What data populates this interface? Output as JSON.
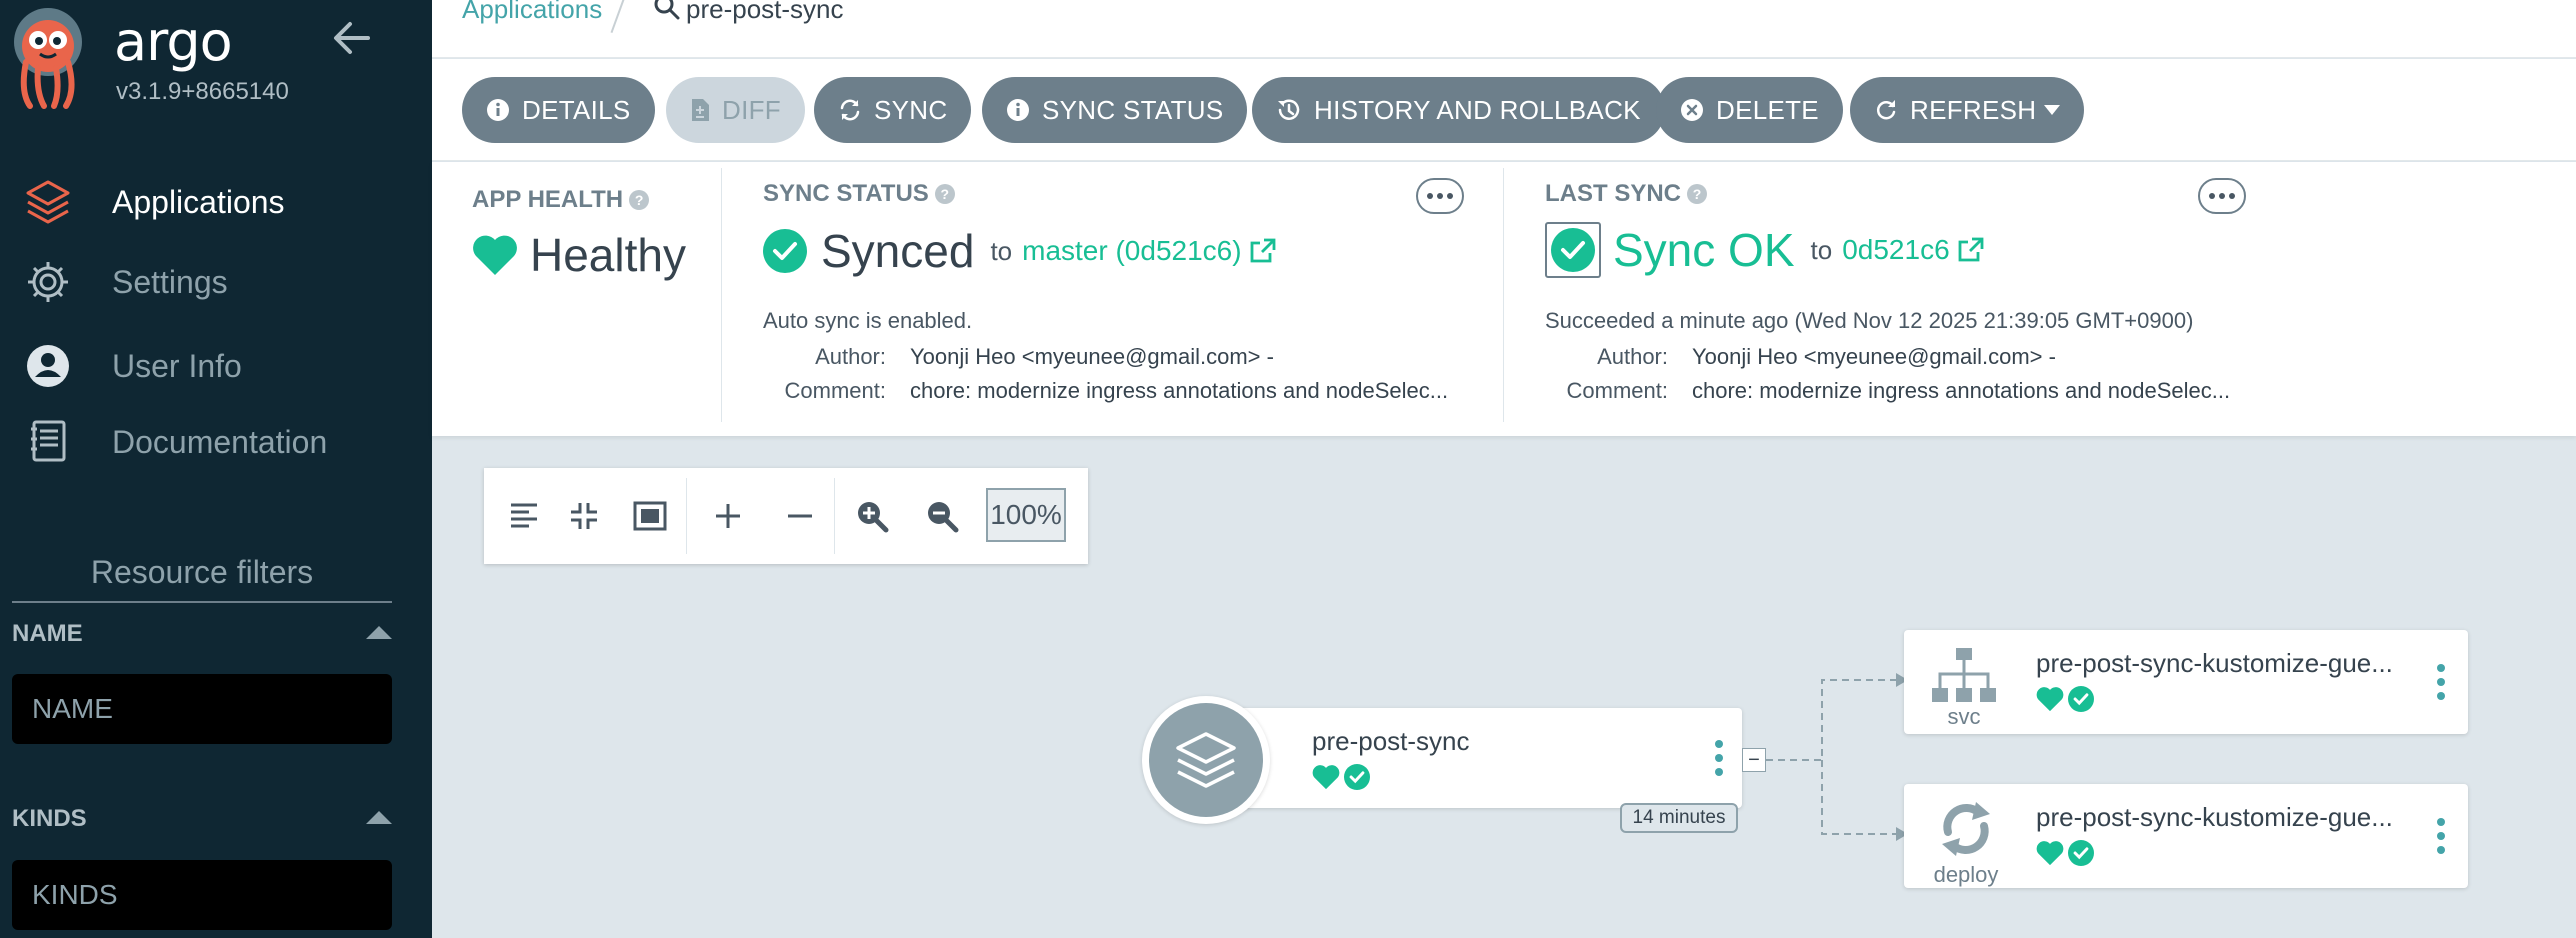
{
  "sidebar": {
    "brand": "argo",
    "version": "v3.1.9+8665140",
    "items": [
      {
        "label": "Applications"
      },
      {
        "label": "Settings"
      },
      {
        "label": "User Info"
      },
      {
        "label": "Documentation"
      }
    ],
    "resource_filters_title": "Resource filters",
    "filters": [
      {
        "label": "NAME",
        "placeholder": "NAME"
      },
      {
        "label": "KINDS",
        "placeholder": "KINDS"
      }
    ]
  },
  "topbar": {
    "breadcrumb_root": "Applications",
    "breadcrumb_current": "pre-post-sync"
  },
  "toolbar": {
    "details": "DETAILS",
    "diff": "DIFF",
    "sync": "SYNC",
    "sync_status": "SYNC STATUS",
    "history": "HISTORY AND ROLLBACK",
    "delete": "DELETE",
    "refresh": "REFRESH"
  },
  "app_health": {
    "title": "APP HEALTH",
    "status": "Healthy"
  },
  "sync_status": {
    "title": "SYNC STATUS",
    "status": "Synced",
    "to": "to",
    "target": "master (0d521c6)",
    "auto_sync": "Auto sync is enabled.",
    "author_label": "Author:",
    "author": "Yoonji Heo <myeunee@gmail.com> -",
    "comment_label": "Comment:",
    "comment": "chore: modernize ingress annotations and nodeSelec..."
  },
  "last_sync": {
    "title": "LAST SYNC",
    "status": "Sync OK",
    "to": "to",
    "revision": "0d521c6",
    "result": "Succeeded a minute ago (Wed Nov 12 2025 21:39:05 GMT+0900)",
    "author_label": "Author:",
    "author": "Yoonji Heo <myeunee@gmail.com> -",
    "comment_label": "Comment:",
    "comment": "chore: modernize ingress annotations and nodeSelec..."
  },
  "graph": {
    "zoom": "100%",
    "app_node": {
      "name": "pre-post-sync",
      "age": "14 minutes"
    },
    "children": [
      {
        "name": "pre-post-sync-kustomize-gue...",
        "kind": "svc"
      },
      {
        "name": "pre-post-sync-kustomize-gue...",
        "kind": "deploy"
      }
    ]
  },
  "colors": {
    "sidebar_bg": "#0f2733",
    "button_bg": "#6d7f8b",
    "healthy": "#18be94",
    "link": "#44a4a9",
    "canvas_bg": "#dee6eb"
  },
  "icons": [
    "argo-logo-icon",
    "arrow-left-icon",
    "layers-icon",
    "gear-icon",
    "user-circle-icon",
    "book-icon",
    "search-icon",
    "info-icon",
    "file-diff-icon",
    "sync-icon",
    "history-icon",
    "close-circle-icon",
    "refresh-icon",
    "heart-icon",
    "check-circle-icon",
    "external-link-icon"
  ]
}
